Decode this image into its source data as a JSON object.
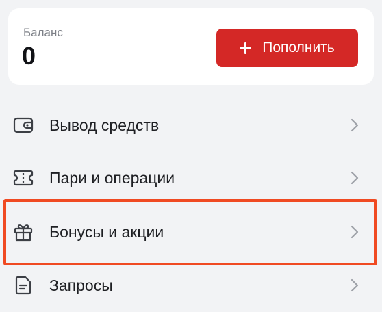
{
  "balance": {
    "label": "Баланс",
    "value": "0"
  },
  "topup": {
    "label": "Пополнить",
    "icon": "plus-icon",
    "color": "#d42826"
  },
  "menu": [
    {
      "label": "Вывод средств",
      "icon": "wallet-icon"
    },
    {
      "label": "Пари и операции",
      "icon": "ticket-icon"
    },
    {
      "label": "Бонусы и акции",
      "icon": "gift-icon",
      "highlighted": true
    },
    {
      "label": "Запросы",
      "icon": "document-icon"
    }
  ],
  "colors": {
    "background": "#f2f3f5",
    "card": "#ffffff",
    "accent": "#d42826",
    "highlight_frame": "#f04a22"
  }
}
